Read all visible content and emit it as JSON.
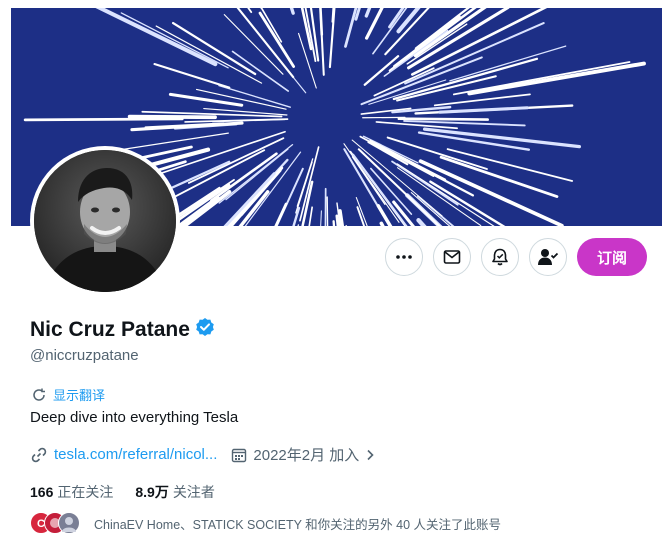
{
  "profile": {
    "name": "Nic Cruz Patane",
    "handle": "@niccruzpatane",
    "translate_label": "显示翻译",
    "bio": "Deep dive into everything Tesla",
    "link_text": "tesla.com/referral/nicol...",
    "joined": "2022年2月 加入",
    "following_count": "166",
    "following_label": "正在关注",
    "followers_count": "8.9万",
    "followers_label": "关注者",
    "followed_by_text": "ChinaEV Home、STATICK SOCIETY 和你关注的另外 40 人关注了此账号"
  },
  "actions": {
    "subscribe_label": "订阅",
    "icons": [
      "more-icon",
      "mail-icon",
      "bell-icon",
      "follow-check-icon"
    ]
  },
  "colors": {
    "accent": "#1d9bf0",
    "subscribe": "#c936c8",
    "banner_bg": "#1d2f86",
    "verified": "#1d9bf0"
  }
}
